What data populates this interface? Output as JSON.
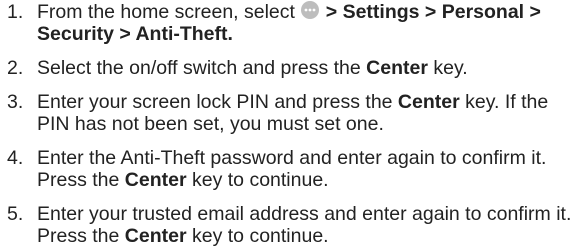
{
  "colors": {
    "text": "#222222",
    "icon_fill": "#bdbdbd"
  },
  "steps": [
    {
      "number": "1.",
      "icon": "more-options-icon",
      "lines": [
        [
          "From the home screen, select ",
          " > Settings > Personal >"
        ],
        [
          "Security > Anti-Theft."
        ]
      ]
    },
    {
      "number": "2.",
      "lines": [
        [
          "Select the on/off switch and press the ",
          "Center",
          " key."
        ]
      ]
    },
    {
      "number": "3.",
      "lines": [
        [
          "Enter your screen lock PIN and press the ",
          "Center",
          " key. If the"
        ],
        [
          "PIN has not been set, you must set one."
        ]
      ]
    },
    {
      "number": "4.",
      "lines": [
        [
          "Enter the Anti-Theft password and enter again to confirm it."
        ],
        [
          "Press the ",
          "Center",
          " key to continue."
        ]
      ]
    },
    {
      "number": "5.",
      "lines": [
        [
          "Enter your trusted email address and enter again to confirm it."
        ],
        [
          "Press the ",
          "Center",
          " key to continue."
        ]
      ]
    }
  ]
}
